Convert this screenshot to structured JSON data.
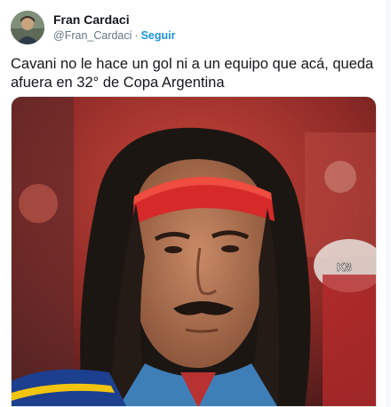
{
  "author": {
    "name": "Fran Cardaci",
    "handle": "@Fran_Cardaci",
    "follow_label": "Seguir"
  },
  "tweet": {
    "text": "Cavani no le hace un gol ni a un equipo que acá, queda afuera en 32° de Copa Argentina"
  },
  "media": {
    "watermark": "K8"
  },
  "icons": {
    "avatar": "user-avatar-photo"
  }
}
